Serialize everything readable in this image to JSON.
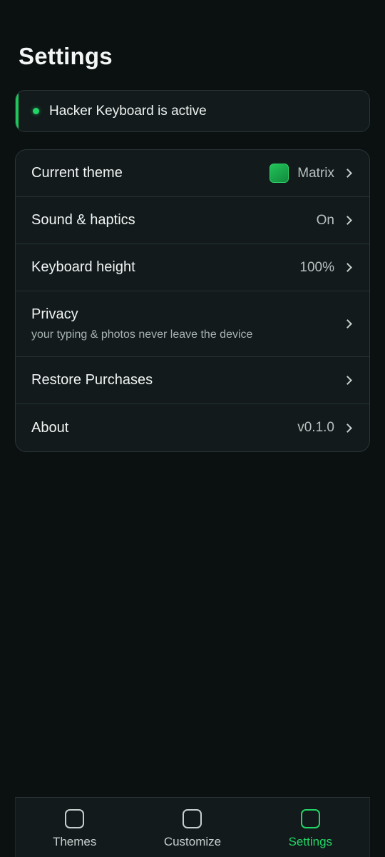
{
  "page": {
    "title": "Settings"
  },
  "status": {
    "text": "Hacker Keyboard is active",
    "color": "#21c45c"
  },
  "settings": {
    "rows": [
      {
        "label": "Current theme",
        "value": "Matrix",
        "icon": "theme-swatch",
        "swatch_color": "#1db954"
      },
      {
        "label": "Sound & haptics",
        "value": "On"
      },
      {
        "label": "Keyboard height",
        "value": "100%"
      },
      {
        "label": "Privacy",
        "subtitle": "your typing & photos never leave the device"
      },
      {
        "label": "Restore Purchases"
      },
      {
        "label": "About",
        "value": "v0.1.0"
      }
    ]
  },
  "tabbar": {
    "tabs": [
      {
        "label": "Themes",
        "icon": "rounded-square-icon",
        "active": false
      },
      {
        "label": "Customize",
        "icon": "rounded-square-icon",
        "active": false
      },
      {
        "label": "Settings",
        "icon": "rounded-square-icon",
        "active": true
      }
    ],
    "active_color": "#22d466"
  }
}
